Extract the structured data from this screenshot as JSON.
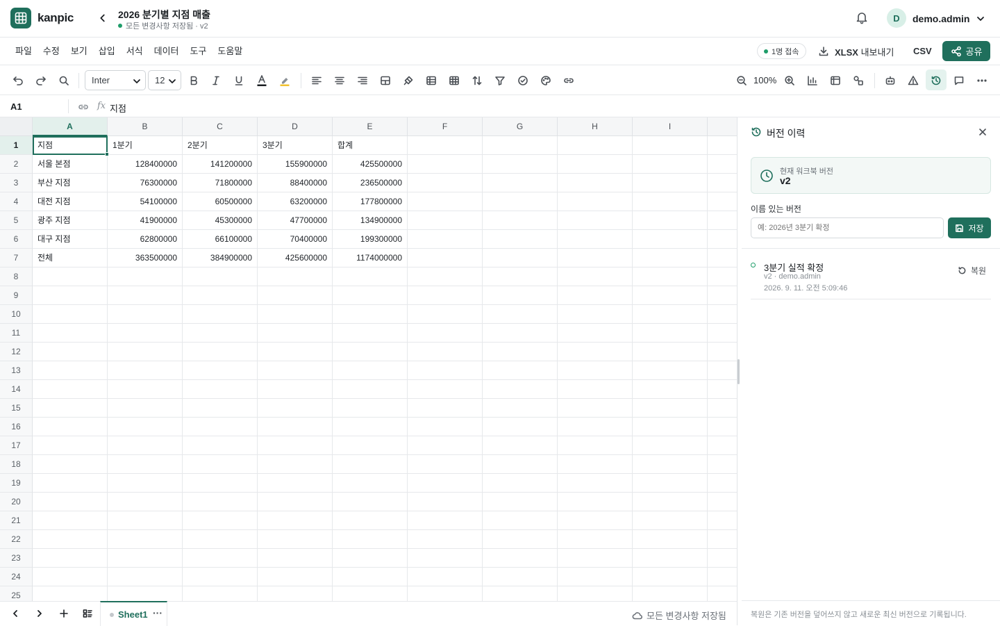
{
  "app": {
    "name": "kanpic"
  },
  "document": {
    "title": "2026 분기별 지점 매출",
    "status": "모든 변경사항 저장됨 · v2"
  },
  "user": {
    "initial": "D",
    "name": "demo.admin"
  },
  "menu": [
    "파일",
    "수정",
    "보기",
    "삽입",
    "서식",
    "데이터",
    "도구",
    "도움말"
  ],
  "header_actions": {
    "presence": "1명 접속",
    "export_xlsx_bold": "XLSX",
    "export_xlsx_rest": "내보내기",
    "export_csv": "CSV",
    "share": "공유"
  },
  "toolbar": {
    "font": "Inter",
    "font_size": "12",
    "zoom": "100%"
  },
  "formula_bar": {
    "cell_ref": "A1",
    "fx": "fx",
    "value": "지점"
  },
  "grid": {
    "columns": [
      "A",
      "B",
      "C",
      "D",
      "E",
      "F",
      "G",
      "H",
      "I"
    ],
    "row_count": 25,
    "rows": [
      [
        "지점",
        "1분기",
        "2분기",
        "3분기",
        "합계"
      ],
      [
        "서울 본점",
        "128400000",
        "141200000",
        "155900000",
        "425500000"
      ],
      [
        "부산 지점",
        "76300000",
        "71800000",
        "88400000",
        "236500000"
      ],
      [
        "대전 지점",
        "54100000",
        "60500000",
        "63200000",
        "177800000"
      ],
      [
        "광주 지점",
        "41900000",
        "45300000",
        "47700000",
        "134900000"
      ],
      [
        "대구 지점",
        "62800000",
        "66100000",
        "70400000",
        "199300000"
      ],
      [
        "전체",
        "363500000",
        "384900000",
        "425600000",
        "1174000000"
      ]
    ],
    "active_cell": "A1"
  },
  "panel": {
    "title": "버전 이력",
    "current_label": "현재 워크북 버전",
    "current_version": "v2",
    "named_label": "이름 있는 버전",
    "named_placeholder": "예: 2026년 3분기 확정",
    "save": "저장",
    "versions": [
      {
        "name": "3분기 실적 확정",
        "meta": "v2 · demo.admin",
        "date": "2026. 9. 11. 오전 5:09:46",
        "restore": "복원"
      }
    ],
    "footer": "복원은 기존 버전을 덮어쓰지 않고 새로운 최신 버전으로 기록됩니다."
  },
  "bottom": {
    "sheet": "Sheet1",
    "sheet_more": "···",
    "save_status": "모든 변경사항 저장됨"
  },
  "colors": {
    "accent": "#1f6f5c",
    "accent_light": "#e3f0ec",
    "status_green": "#1f9d6a"
  }
}
